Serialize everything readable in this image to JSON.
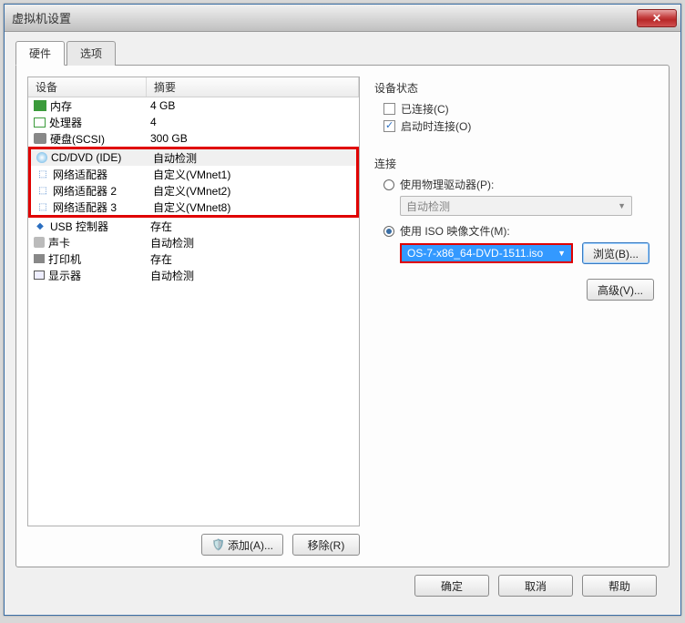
{
  "window": {
    "title": "虚拟机设置"
  },
  "tabs": {
    "hardware": "硬件",
    "options": "选项"
  },
  "list": {
    "headers": {
      "device": "设备",
      "summary": "摘要"
    },
    "rows": [
      {
        "name": "内存",
        "summary": "4 GB",
        "icon": "ic-mem",
        "hl": false
      },
      {
        "name": "处理器",
        "summary": "4",
        "icon": "ic-cpu",
        "hl": false
      },
      {
        "name": "硬盘(SCSI)",
        "summary": "300 GB",
        "icon": "ic-hdd",
        "hl": false
      },
      {
        "name": "CD/DVD (IDE)",
        "summary": "自动检测",
        "icon": "ic-cd",
        "hl": true
      },
      {
        "name": "网络适配器",
        "summary": "自定义(VMnet1)",
        "icon": "ic-net",
        "hl": true
      },
      {
        "name": "网络适配器 2",
        "summary": "自定义(VMnet2)",
        "icon": "ic-net",
        "hl": true
      },
      {
        "name": "网络适配器 3",
        "summary": "自定义(VMnet8)",
        "icon": "ic-net",
        "hl": true
      },
      {
        "name": "USB 控制器",
        "summary": "存在",
        "icon": "ic-usb",
        "hl": false
      },
      {
        "name": "声卡",
        "summary": "自动检测",
        "icon": "ic-snd",
        "hl": false
      },
      {
        "name": "打印机",
        "summary": "存在",
        "icon": "ic-prn",
        "hl": false
      },
      {
        "name": "显示器",
        "summary": "自动检测",
        "icon": "ic-disp",
        "hl": false
      }
    ]
  },
  "right": {
    "status_title": "设备状态",
    "connected": "已连接(C)",
    "connect_on_power": "启动时连接(O)",
    "connection_title": "连接",
    "use_physical": "使用物理驱动器(P):",
    "physical_auto": "自动检测",
    "use_iso": "使用 ISO 映像文件(M):",
    "iso_value": "OS-7-x86_64-DVD-1511.iso",
    "browse": "浏览(B)...",
    "advanced": "高级(V)..."
  },
  "buttons": {
    "add": "添加(A)...",
    "remove": "移除(R)",
    "ok": "确定",
    "cancel": "取消",
    "help": "帮助"
  }
}
